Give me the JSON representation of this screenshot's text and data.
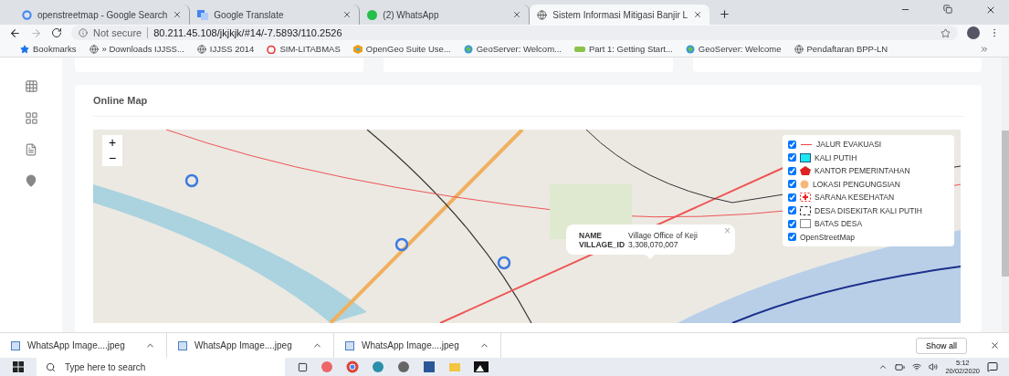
{
  "browser": {
    "tabs": [
      {
        "title": "openstreetmap - Google Search",
        "selected": false
      },
      {
        "title": "Google Translate",
        "selected": false
      },
      {
        "title": "(2) WhatsApp",
        "selected": false
      },
      {
        "title": "Sistem Informasi Mitigasi Banjir L",
        "selected": true
      }
    ],
    "security": "Not secure",
    "url": "80.211.45.108/jkjkjk/#14/-7.5893/110.2526",
    "bookmarks": [
      {
        "label": "Bookmarks"
      },
      {
        "label": "» Downloads IJJSS..."
      },
      {
        "label": "IJJSS 2014"
      },
      {
        "label": "SIM-LITABMAS"
      },
      {
        "label": "OpenGeo Suite Use..."
      },
      {
        "label": "GeoServer: Welcom..."
      },
      {
        "label": "Part 1: Getting Start..."
      },
      {
        "label": "GeoServer: Welcome"
      },
      {
        "label": "Pendaftaran BPP-LN"
      }
    ]
  },
  "page": {
    "map_card": {
      "title": "Online Map",
      "zoom": [
        "+",
        "−"
      ],
      "legend": [
        {
          "label": "JALUR EVAKUASI",
          "checked": true,
          "kind": "line"
        },
        {
          "label": "KALI PUTIH",
          "checked": true,
          "kind": "fill"
        },
        {
          "label": "KANTOR PEMERINTAHAN",
          "checked": true,
          "kind": "pentagon"
        },
        {
          "label": "LOKASI PENGUNGSIAN",
          "checked": true,
          "kind": "circle"
        },
        {
          "label": "SARANA KESEHATAN",
          "checked": true,
          "kind": "cross"
        },
        {
          "label": "DESA DISEKITAR KALI PUTIH",
          "checked": true,
          "kind": "dashed"
        },
        {
          "label": "BATAS DESA",
          "checked": true,
          "kind": "outline"
        },
        {
          "label": "OpenStreetMap",
          "checked": true,
          "kind": "none"
        }
      ],
      "popup": {
        "rows": [
          {
            "key": "NAME",
            "value": "Village Office of Keji"
          },
          {
            "key": "VILLAGE_ID",
            "value": "3,308,070,007"
          }
        ],
        "close": "×"
      }
    }
  },
  "downloads": {
    "items": [
      "WhatsApp Image....jpeg",
      "WhatsApp Image....jpeg",
      "WhatsApp Image....jpeg"
    ],
    "show_all": "Show all"
  },
  "taskbar": {
    "search_placeholder": "Type here to search",
    "time": "5:12",
    "date": "20/02/2020"
  }
}
